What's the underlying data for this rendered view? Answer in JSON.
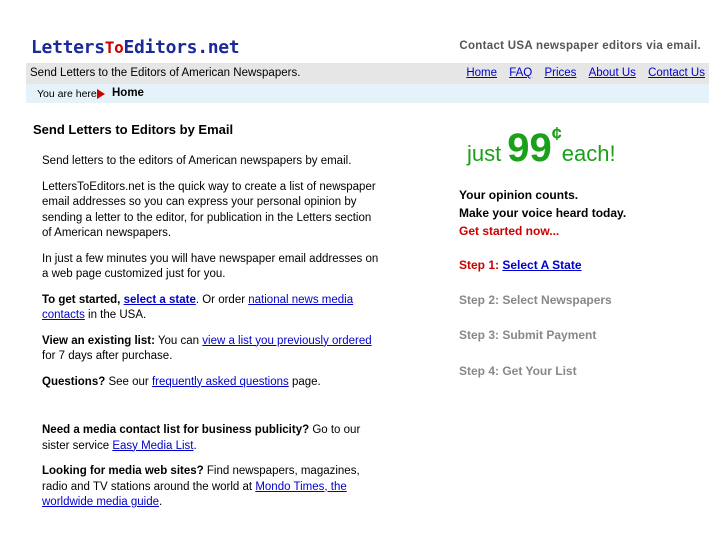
{
  "header": {
    "logo_part1": "Letters",
    "logo_part2": "To",
    "logo_part3": "Editors.net",
    "tagline": "Contact USA newspaper editors via email."
  },
  "navbar": {
    "description": "Send Letters to the Editors of American Newspapers.",
    "links": [
      "Home",
      "FAQ",
      "Prices",
      "About Us",
      "Contact Us"
    ]
  },
  "breadcrumb": {
    "prefix": "You are here",
    "current": "Home"
  },
  "main": {
    "title": "Send Letters to Editors by Email",
    "p1": "Send letters to the editors of American newspapers by email.",
    "p2": "LettersToEditors.net is the quick way to create a list of newspaper email addresses so you can express your personal opinion by sending a letter to the editor, for publication in the Letters section of American newspapers.",
    "p3": "In just a few minutes you will have newspaper email addresses on a web page customized just for you.",
    "p4_bold": "To get started,",
    "p4_link1": "select a state",
    "p4_mid": ". Or order",
    "p4_link2": "national news media contacts",
    "p4_end": "in the USA.",
    "p5_bold": "View an existing list:",
    "p5_pre": "You can",
    "p5_link": "view a list you previously ordered",
    "p5_end": "for 7 days after purchase.",
    "p6_bold": "Questions?",
    "p6_pre": "See our",
    "p6_link": "frequently asked questions",
    "p6_end": "page.",
    "p7_bold": "Need a media contact list for business publicity?",
    "p7_pre": "Go to our sister service",
    "p7_link": "Easy Media List",
    "p7_end": ".",
    "p8_bold": "Looking for media web sites?",
    "p8_pre": "Find newspapers, magazines, radio and TV stations around the world at",
    "p8_link": "Mondo Times, the worldwide media guide",
    "p8_end": "."
  },
  "sidebar": {
    "price_just": "just",
    "price_num": "99",
    "price_cent": "¢",
    "price_each": "each!",
    "pitch1": "Your opinion counts.",
    "pitch2": "Make your voice heard today.",
    "pitch3": "Get started now...",
    "step1_label": "Step 1:",
    "step1_link": "Select A State",
    "step2": "Step 2: Select Newspapers",
    "step3": "Step 3: Submit Payment",
    "step4": "Step 4: Get Your List"
  },
  "colors": {
    "logo_blue": "#1a2a9a",
    "logo_red": "#cc0000",
    "price_green": "#1aa11a",
    "link_blue": "#0000cc",
    "step_gray": "#888888"
  }
}
